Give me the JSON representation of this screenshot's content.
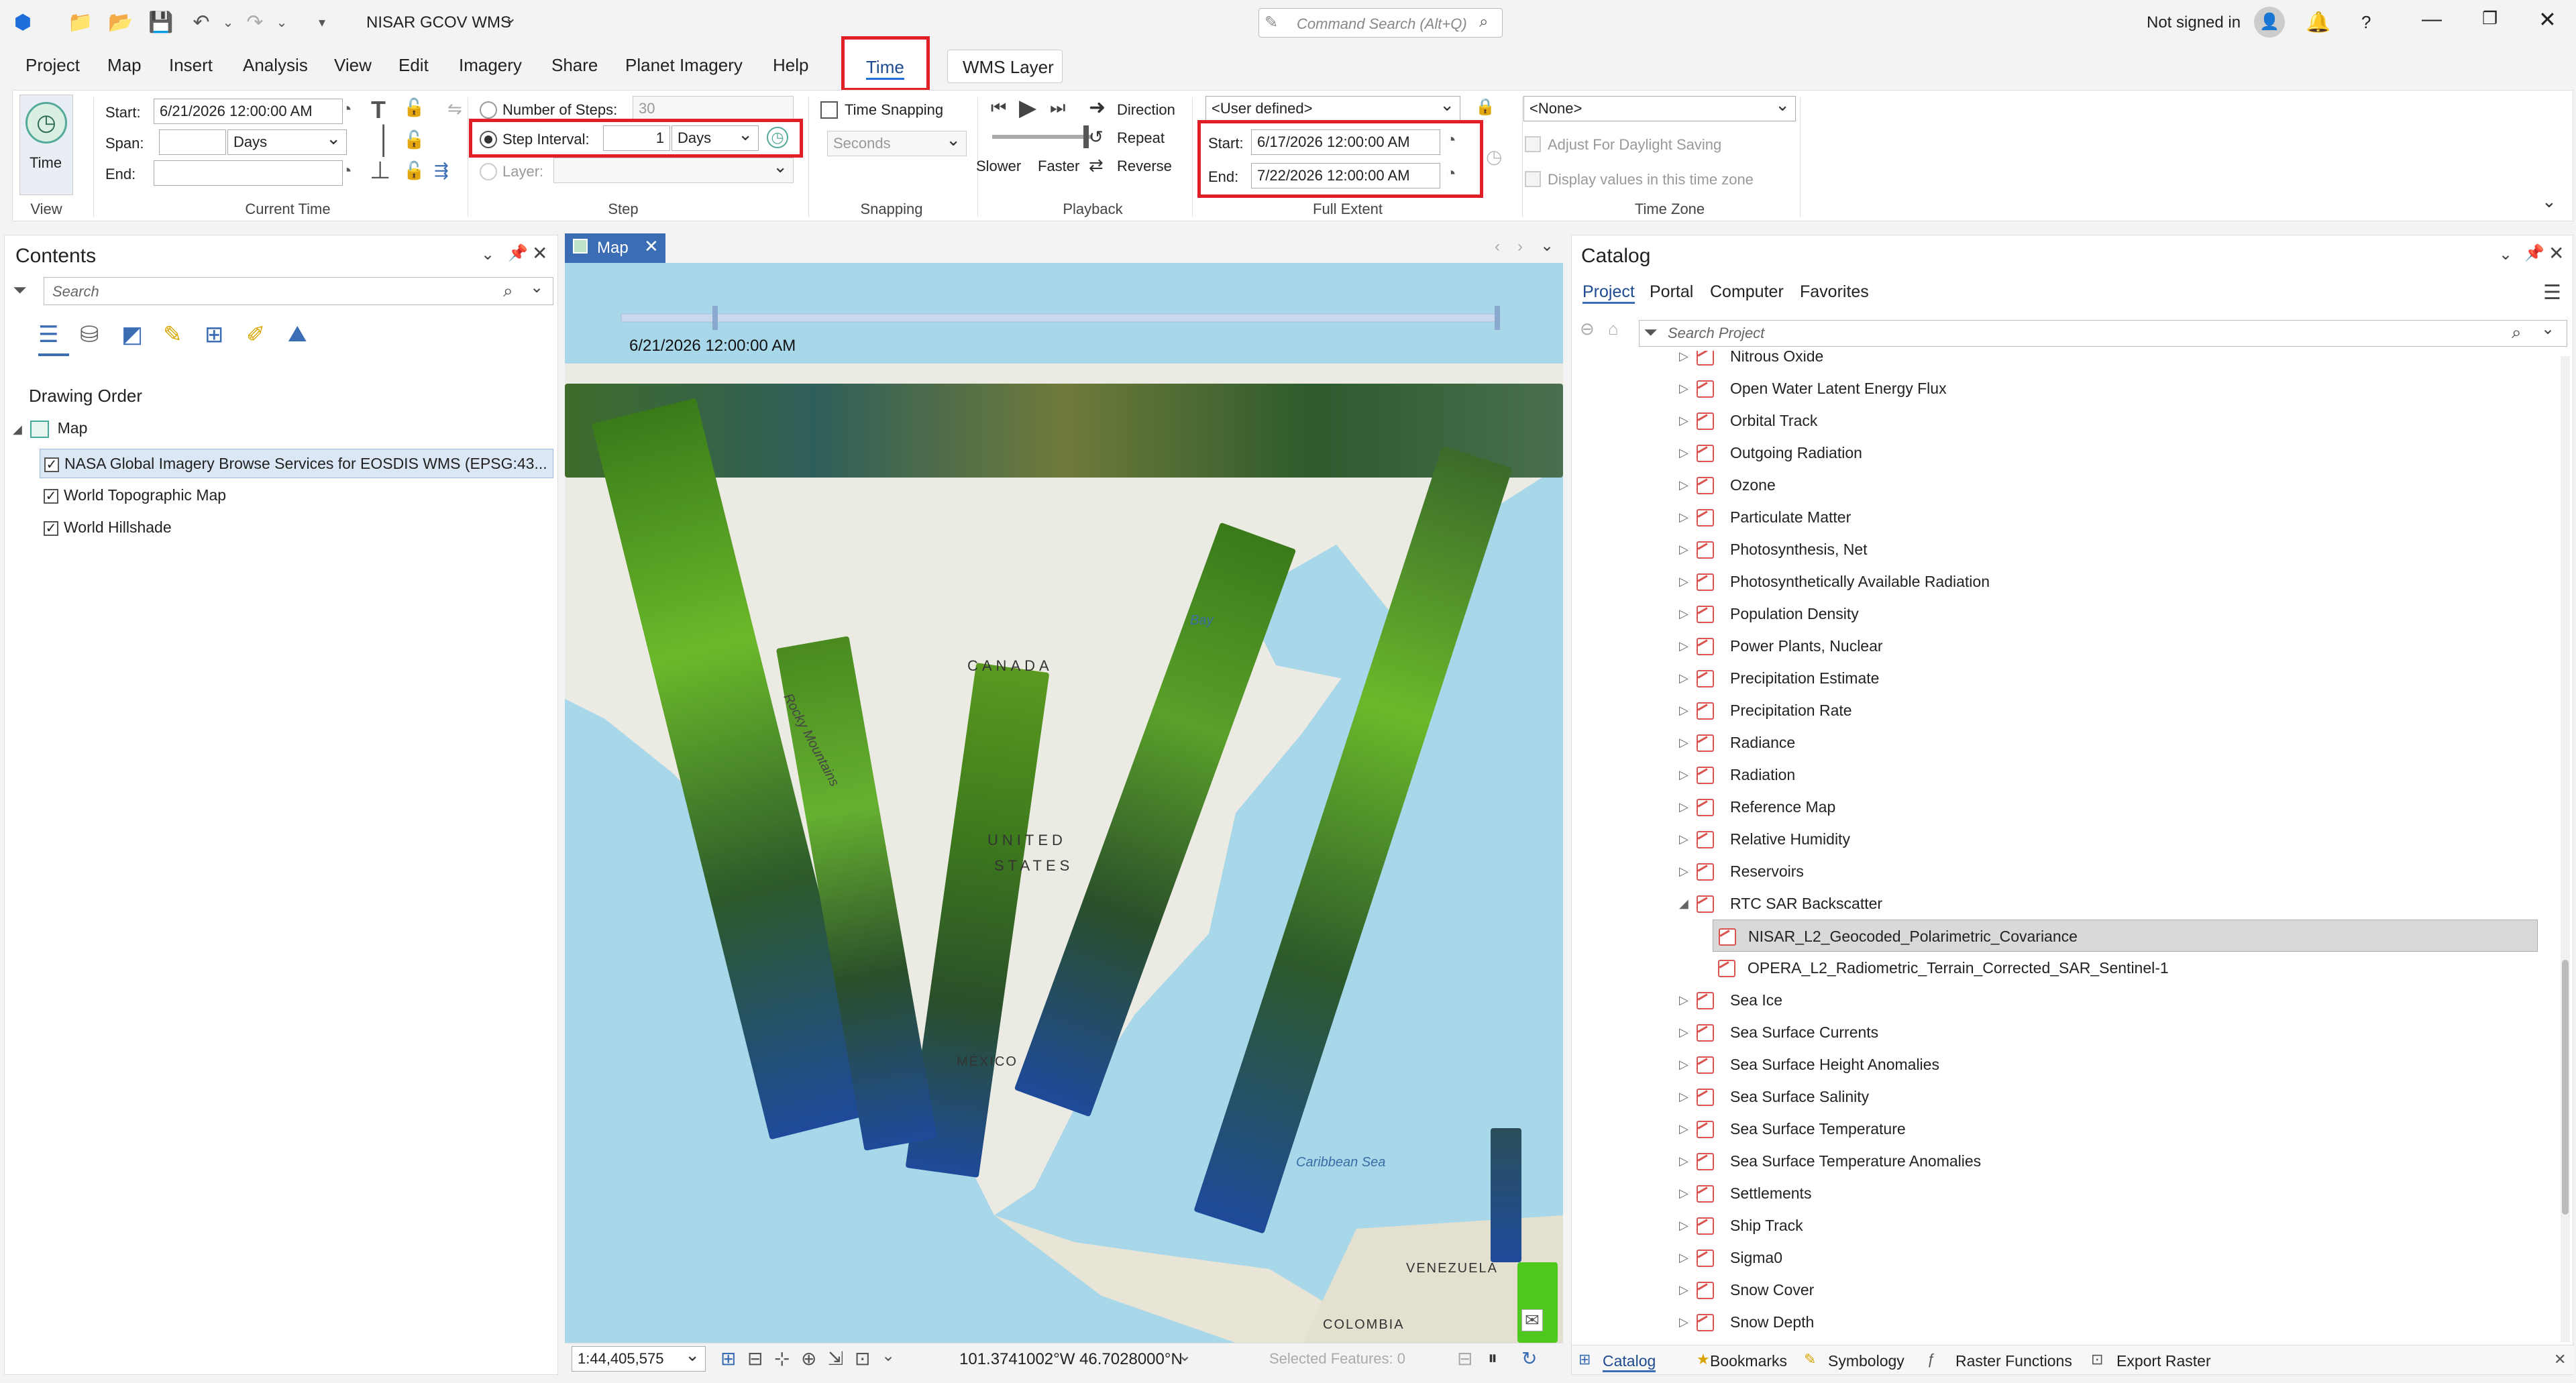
{
  "app": {
    "project_title": "NISAR GCOV WMS",
    "command_search_placeholder": "Command Search (Alt+Q)",
    "signin": "Not signed in",
    "help": "?"
  },
  "ribbon_tabs": [
    "Project",
    "Map",
    "Insert",
    "Analysis",
    "View",
    "Edit",
    "Imagery",
    "Share",
    "Planet Imagery",
    "Help",
    "Time",
    "WMS Layer"
  ],
  "active_tab": "Time",
  "view_group": {
    "button": "Time",
    "label": "View"
  },
  "current_time": {
    "start_label": "Start:",
    "start_value": "6/21/2026 12:00:00 AM",
    "span_label": "Span:",
    "span_value": "",
    "span_unit": "Days",
    "end_label": "End:",
    "end_value": "",
    "group_label": "Current Time"
  },
  "step": {
    "num_steps_label": "Number of Steps:",
    "num_steps_value": "30",
    "interval_label": "Step Interval:",
    "interval_value": "1",
    "interval_unit": "Days",
    "layer_label": "Layer:",
    "layer_value": "",
    "group_label": "Step"
  },
  "snapping": {
    "label": "Time Snapping",
    "unit": "Seconds",
    "group_label": "Snapping"
  },
  "playback": {
    "slower": "Slower",
    "faster": "Faster",
    "direction": "Direction",
    "repeat": "Repeat",
    "reverse": "Reverse",
    "group_label": "Playback"
  },
  "full_extent": {
    "mode": "<User defined>",
    "start_label": "Start:",
    "start_value": "6/17/2026 12:00:00 AM",
    "end_label": "End:",
    "end_value": "7/22/2026 12:00:00 AM",
    "group_label": "Full Extent"
  },
  "time_zone": {
    "value": "<None>",
    "dst": "Adjust For Daylight Saving",
    "display": "Display values in this time zone",
    "group_label": "Time Zone"
  },
  "contents": {
    "title": "Contents",
    "search_placeholder": "Search",
    "drawing_order": "Drawing Order",
    "map_label": "Map",
    "layers": [
      "NASA Global Imagery Browse Services for EOSDIS WMS (EPSG:43...",
      "World Topographic Map",
      "World Hillshade"
    ]
  },
  "map": {
    "tab": "Map",
    "time_label": "6/21/2026 12:00:00 AM",
    "scale": "1:44,405,575",
    "coords": "101.3741002°W 46.7028000°N",
    "selected_features": "Selected Features: 0",
    "place_labels": [
      "CANADA",
      "UNITED",
      "STATES",
      "MÉXICO",
      "VENEZUELA",
      "COLOMBIA",
      "Rocky Mountains",
      "Bay",
      "Caribbean Sea"
    ]
  },
  "catalog": {
    "title": "Catalog",
    "tabs": [
      "Project",
      "Portal",
      "Computer",
      "Favorites"
    ],
    "search_placeholder": "Search Project",
    "items": [
      "Nitrous Oxide",
      "Open Water Latent Energy Flux",
      "Orbital Track",
      "Outgoing Radiation",
      "Ozone",
      "Particulate Matter",
      "Photosynthesis, Net",
      "Photosynthetically Available Radiation",
      "Population Density",
      "Power Plants, Nuclear",
      "Precipitation Estimate",
      "Precipitation Rate",
      "Radiance",
      "Radiation",
      "Reference Map",
      "Relative Humidity",
      "Reservoirs",
      "RTC SAR Backscatter"
    ],
    "sub_items": [
      "NISAR_L2_Geocoded_Polarimetric_Covariance",
      "OPERA_L2_Radiometric_Terrain_Corrected_SAR_Sentinel-1"
    ],
    "items_after": [
      "Sea Ice",
      "Sea Surface Currents",
      "Sea Surface Height Anomalies",
      "Sea Surface Salinity",
      "Sea Surface Temperature",
      "Sea Surface Temperature Anomalies",
      "Settlements",
      "Ship Track",
      "Sigma0",
      "Snow Cover",
      "Snow Depth"
    ],
    "bottom_tabs": [
      "Catalog",
      "Bookmarks",
      "Symbology",
      "Raster Functions",
      "Export Raster"
    ]
  }
}
